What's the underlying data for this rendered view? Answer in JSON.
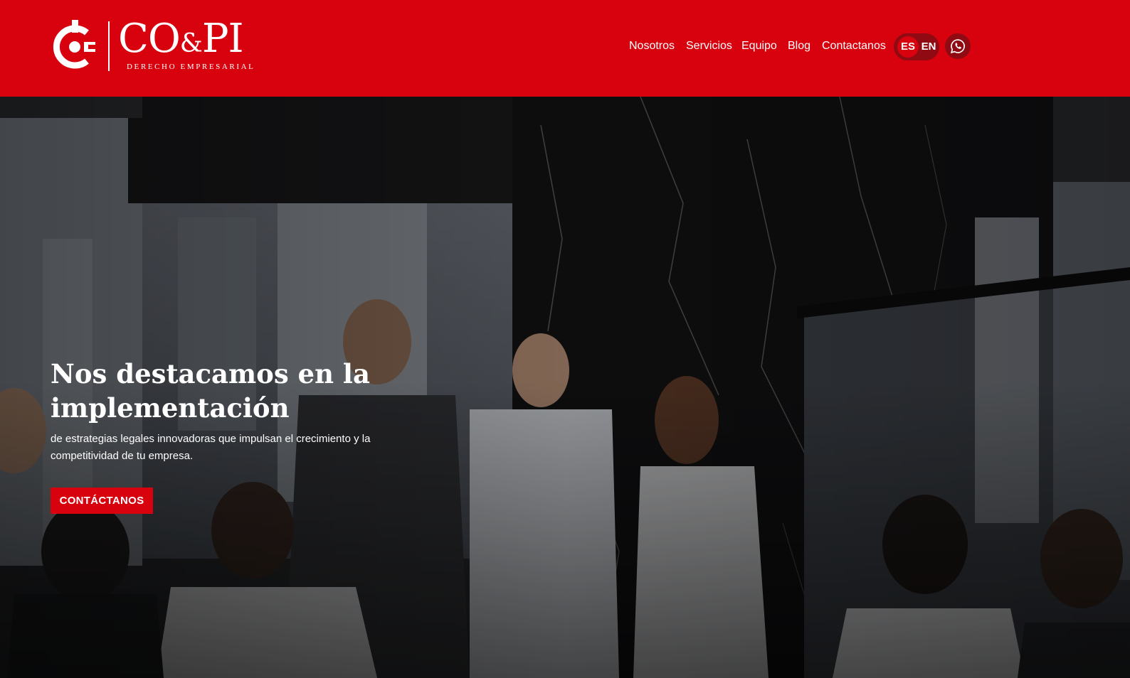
{
  "brand": {
    "name_left": "CO",
    "name_amp": "&",
    "name_right": "PI",
    "tagline": "DERECHO EMPRESARIAL",
    "logo_icon": "copi-circle-logo-icon",
    "primary_color": "#d8020f",
    "dark_accent": "#8f0a12"
  },
  "nav": {
    "items": [
      {
        "label": "Nosotros"
      },
      {
        "label": "Servicios"
      },
      {
        "label": "Equipo"
      },
      {
        "label": "Blog"
      },
      {
        "label": "Contactanos"
      }
    ],
    "lang_active": "ES",
    "lang_other": "EN",
    "whatsapp_icon": "whatsapp-icon"
  },
  "hero": {
    "title": "Nos destacamos en la implementación",
    "subtitle": "de estrategias legales innovadoras que impulsan el crecimiento y la competitividad de tu empresa.",
    "cta_label": "CONTÁCTANOS",
    "background": "office-team-meeting-photo"
  }
}
